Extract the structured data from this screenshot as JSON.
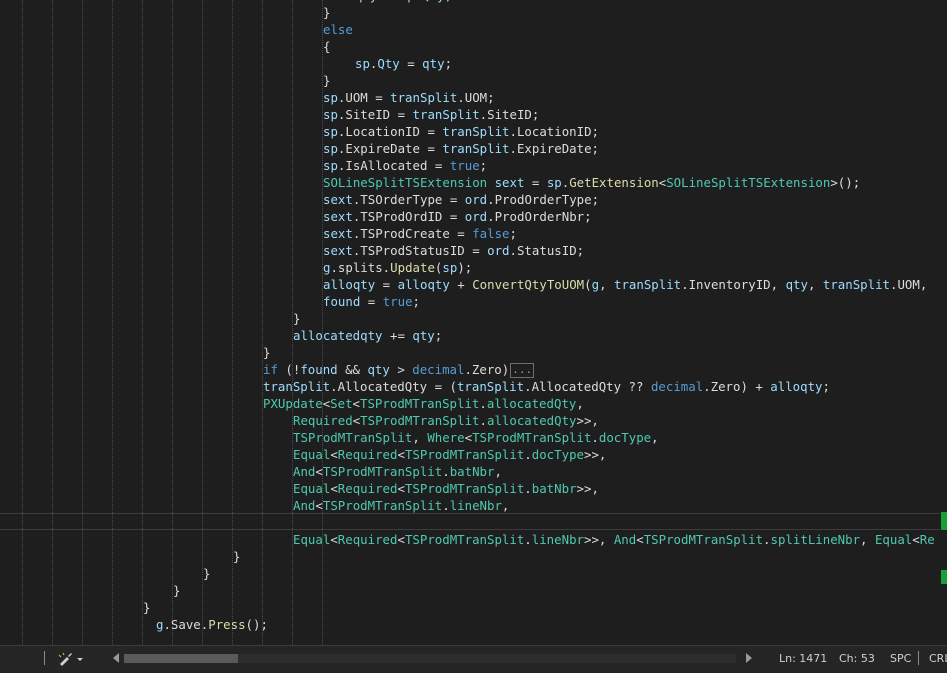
{
  "code_lines": [
    [
      {
        "c": "v",
        "t": "qty"
      },
      {
        "c": "p",
        "t": " = "
      },
      {
        "c": "v",
        "t": "sp"
      },
      {
        "c": "p",
        "t": "."
      },
      {
        "c": "v",
        "t": "Qty"
      },
      {
        "c": "p",
        "t": ";"
      }
    ],
    [
      {
        "c": "p",
        "t": "}"
      }
    ],
    [
      {
        "c": "k",
        "t": "else"
      }
    ],
    [
      {
        "c": "p",
        "t": "{"
      }
    ],
    [
      {
        "c": "v",
        "t": "sp"
      },
      {
        "c": "p",
        "t": "."
      },
      {
        "c": "v",
        "t": "Qty"
      },
      {
        "c": "p",
        "t": " = "
      },
      {
        "c": "v",
        "t": "qty"
      },
      {
        "c": "p",
        "t": ";"
      }
    ],
    [
      {
        "c": "p",
        "t": "}"
      }
    ],
    [
      {
        "c": "v",
        "t": "sp"
      },
      {
        "c": "p",
        "t": ".UOM = "
      },
      {
        "c": "v",
        "t": "tranSplit"
      },
      {
        "c": "p",
        "t": ".UOM;"
      }
    ],
    [
      {
        "c": "v",
        "t": "sp"
      },
      {
        "c": "p",
        "t": ".SiteID = "
      },
      {
        "c": "v",
        "t": "tranSplit"
      },
      {
        "c": "p",
        "t": ".SiteID;"
      }
    ],
    [
      {
        "c": "v",
        "t": "sp"
      },
      {
        "c": "p",
        "t": ".LocationID = "
      },
      {
        "c": "v",
        "t": "tranSplit"
      },
      {
        "c": "p",
        "t": ".LocationID;"
      }
    ],
    [
      {
        "c": "v",
        "t": "sp"
      },
      {
        "c": "p",
        "t": ".ExpireDate = "
      },
      {
        "c": "v",
        "t": "tranSplit"
      },
      {
        "c": "p",
        "t": ".ExpireDate;"
      }
    ],
    [
      {
        "c": "v",
        "t": "sp"
      },
      {
        "c": "p",
        "t": ".IsAllocated = "
      },
      {
        "c": "k",
        "t": "true"
      },
      {
        "c": "p",
        "t": ";"
      }
    ],
    [
      {
        "c": "t",
        "t": "SOLineSplitTSExtension"
      },
      {
        "c": "p",
        "t": " "
      },
      {
        "c": "v",
        "t": "sext"
      },
      {
        "c": "p",
        "t": " = "
      },
      {
        "c": "v",
        "t": "sp"
      },
      {
        "c": "p",
        "t": "."
      },
      {
        "c": "m",
        "t": "GetExtension"
      },
      {
        "c": "p",
        "t": "<"
      },
      {
        "c": "t",
        "t": "SOLineSplitTSExtension"
      },
      {
        "c": "p",
        "t": ">();"
      }
    ],
    [
      {
        "c": "v",
        "t": "sext"
      },
      {
        "c": "p",
        "t": ".TSOrderType = "
      },
      {
        "c": "v",
        "t": "ord"
      },
      {
        "c": "p",
        "t": ".ProdOrderType;"
      }
    ],
    [
      {
        "c": "v",
        "t": "sext"
      },
      {
        "c": "p",
        "t": ".TSProdOrdID = "
      },
      {
        "c": "v",
        "t": "ord"
      },
      {
        "c": "p",
        "t": ".ProdOrderNbr;"
      }
    ],
    [
      {
        "c": "v",
        "t": "sext"
      },
      {
        "c": "p",
        "t": ".TSProdCreate = "
      },
      {
        "c": "k",
        "t": "false"
      },
      {
        "c": "p",
        "t": ";"
      }
    ],
    [
      {
        "c": "v",
        "t": "sext"
      },
      {
        "c": "p",
        "t": ".TSProdStatusID = "
      },
      {
        "c": "v",
        "t": "ord"
      },
      {
        "c": "p",
        "t": ".StatusID;"
      }
    ],
    [
      {
        "c": "v",
        "t": "g"
      },
      {
        "c": "p",
        "t": ".splits."
      },
      {
        "c": "m",
        "t": "Update"
      },
      {
        "c": "p",
        "t": "("
      },
      {
        "c": "v",
        "t": "sp"
      },
      {
        "c": "p",
        "t": ");"
      }
    ],
    [
      {
        "c": "v",
        "t": "alloqty"
      },
      {
        "c": "p",
        "t": " = "
      },
      {
        "c": "v",
        "t": "alloqty"
      },
      {
        "c": "p",
        "t": " + "
      },
      {
        "c": "m",
        "t": "ConvertQtyToUOM"
      },
      {
        "c": "p",
        "t": "("
      },
      {
        "c": "v",
        "t": "g"
      },
      {
        "c": "p",
        "t": ", "
      },
      {
        "c": "v",
        "t": "tranSplit"
      },
      {
        "c": "p",
        "t": ".InventoryID, "
      },
      {
        "c": "v",
        "t": "qty"
      },
      {
        "c": "p",
        "t": ", "
      },
      {
        "c": "v",
        "t": "tranSplit"
      },
      {
        "c": "p",
        "t": ".UOM,"
      }
    ],
    [
      {
        "c": "v",
        "t": "found"
      },
      {
        "c": "p",
        "t": " = "
      },
      {
        "c": "k",
        "t": "true"
      },
      {
        "c": "p",
        "t": ";"
      }
    ],
    [
      {
        "c": "p",
        "t": "}"
      }
    ],
    [
      {
        "c": "v",
        "t": "allocatedqty"
      },
      {
        "c": "p",
        "t": " += "
      },
      {
        "c": "v",
        "t": "qty"
      },
      {
        "c": "p",
        "t": ";"
      }
    ],
    [
      {
        "c": "p",
        "t": "}"
      }
    ],
    [
      {
        "c": "k",
        "t": "if"
      },
      {
        "c": "p",
        "t": " (!"
      },
      {
        "c": "v",
        "t": "found"
      },
      {
        "c": "p",
        "t": " && "
      },
      {
        "c": "v",
        "t": "qty"
      },
      {
        "c": "p",
        "t": " > "
      },
      {
        "c": "k",
        "t": "decimal"
      },
      {
        "c": "p",
        "t": ".Zero)"
      }
    ],
    [
      {
        "c": "v",
        "t": "tranSplit"
      },
      {
        "c": "p",
        "t": ".AllocatedQty = ("
      },
      {
        "c": "v",
        "t": "tranSplit"
      },
      {
        "c": "p",
        "t": ".AllocatedQty ?? "
      },
      {
        "c": "k",
        "t": "decimal"
      },
      {
        "c": "p",
        "t": ".Zero) + "
      },
      {
        "c": "v",
        "t": "alloqty"
      },
      {
        "c": "p",
        "t": ";"
      }
    ],
    [
      {
        "c": "t",
        "t": "PXUpdate"
      },
      {
        "c": "p",
        "t": "<"
      },
      {
        "c": "t",
        "t": "Set"
      },
      {
        "c": "p",
        "t": "<"
      },
      {
        "c": "t",
        "t": "TSProdMTranSplit"
      },
      {
        "c": "p",
        "t": "."
      },
      {
        "c": "t",
        "t": "allocatedQty"
      },
      {
        "c": "p",
        "t": ","
      }
    ],
    [
      {
        "c": "t",
        "t": "Required"
      },
      {
        "c": "p",
        "t": "<"
      },
      {
        "c": "t",
        "t": "TSProdMTranSplit"
      },
      {
        "c": "p",
        "t": "."
      },
      {
        "c": "t",
        "t": "allocatedQty"
      },
      {
        "c": "p",
        "t": ">>,"
      }
    ],
    [
      {
        "c": "t",
        "t": "TSProdMTranSplit"
      },
      {
        "c": "p",
        "t": ", "
      },
      {
        "c": "t",
        "t": "Where"
      },
      {
        "c": "p",
        "t": "<"
      },
      {
        "c": "t",
        "t": "TSProdMTranSplit"
      },
      {
        "c": "p",
        "t": "."
      },
      {
        "c": "t",
        "t": "docType"
      },
      {
        "c": "p",
        "t": ","
      }
    ],
    [
      {
        "c": "t",
        "t": "Equal"
      },
      {
        "c": "p",
        "t": "<"
      },
      {
        "c": "t",
        "t": "Required"
      },
      {
        "c": "p",
        "t": "<"
      },
      {
        "c": "t",
        "t": "TSProdMTranSplit"
      },
      {
        "c": "p",
        "t": "."
      },
      {
        "c": "t",
        "t": "docType"
      },
      {
        "c": "p",
        "t": ">>,"
      }
    ],
    [
      {
        "c": "t",
        "t": "And"
      },
      {
        "c": "p",
        "t": "<"
      },
      {
        "c": "t",
        "t": "TSProdMTranSplit"
      },
      {
        "c": "p",
        "t": "."
      },
      {
        "c": "t",
        "t": "batNbr"
      },
      {
        "c": "p",
        "t": ","
      }
    ],
    [
      {
        "c": "t",
        "t": "Equal"
      },
      {
        "c": "p",
        "t": "<"
      },
      {
        "c": "t",
        "t": "Required"
      },
      {
        "c": "p",
        "t": "<"
      },
      {
        "c": "t",
        "t": "TSProdMTranSplit"
      },
      {
        "c": "p",
        "t": "."
      },
      {
        "c": "t",
        "t": "batNbr"
      },
      {
        "c": "p",
        "t": ">>,"
      }
    ],
    [
      {
        "c": "t",
        "t": "And"
      },
      {
        "c": "p",
        "t": "<"
      },
      {
        "c": "t",
        "t": "TSProdMTranSplit"
      },
      {
        "c": "p",
        "t": "."
      },
      {
        "c": "t",
        "t": "lineNbr"
      },
      {
        "c": "p",
        "t": ","
      }
    ],
    [],
    [
      {
        "c": "t",
        "t": "Equal"
      },
      {
        "c": "p",
        "t": "<"
      },
      {
        "c": "t",
        "t": "Required"
      },
      {
        "c": "p",
        "t": "<"
      },
      {
        "c": "t",
        "t": "TSProdMTranSplit"
      },
      {
        "c": "p",
        "t": "."
      },
      {
        "c": "t",
        "t": "lineNbr"
      },
      {
        "c": "p",
        "t": ">>, "
      },
      {
        "c": "t",
        "t": "And"
      },
      {
        "c": "p",
        "t": "<"
      },
      {
        "c": "t",
        "t": "TSProdMTranSplit"
      },
      {
        "c": "p",
        "t": "."
      },
      {
        "c": "t",
        "t": "splitLineNbr"
      },
      {
        "c": "p",
        "t": ", "
      },
      {
        "c": "t",
        "t": "Equal"
      },
      {
        "c": "p",
        "t": "<"
      },
      {
        "c": "t",
        "t": "Re"
      }
    ],
    [
      {
        "c": "p",
        "t": "}"
      }
    ],
    [
      {
        "c": "p",
        "t": "}"
      }
    ],
    [
      {
        "c": "p",
        "t": "}"
      }
    ],
    [
      {
        "c": "p",
        "t": "}"
      }
    ],
    [
      {
        "c": "v",
        "t": "g"
      },
      {
        "c": "p",
        "t": ".Save."
      },
      {
        "c": "m",
        "t": "Press"
      },
      {
        "c": "p",
        "t": "();"
      }
    ]
  ],
  "collapsed_marker": "...",
  "colors": {
    "background": "#1e1e1e",
    "variable": "#9cdcfe",
    "type": "#4ec9b0",
    "keyword": "#569cd6",
    "method": "#dcdcaa",
    "punctuation": "#dcdcdc",
    "scroll_marker": "#1a9e3a"
  },
  "statusbar": {
    "cleanup_icon": "broom-icon",
    "line": "Ln: 1471",
    "column": "Ch: 53",
    "whitespace": "SPC",
    "line_ending": "CRL"
  }
}
